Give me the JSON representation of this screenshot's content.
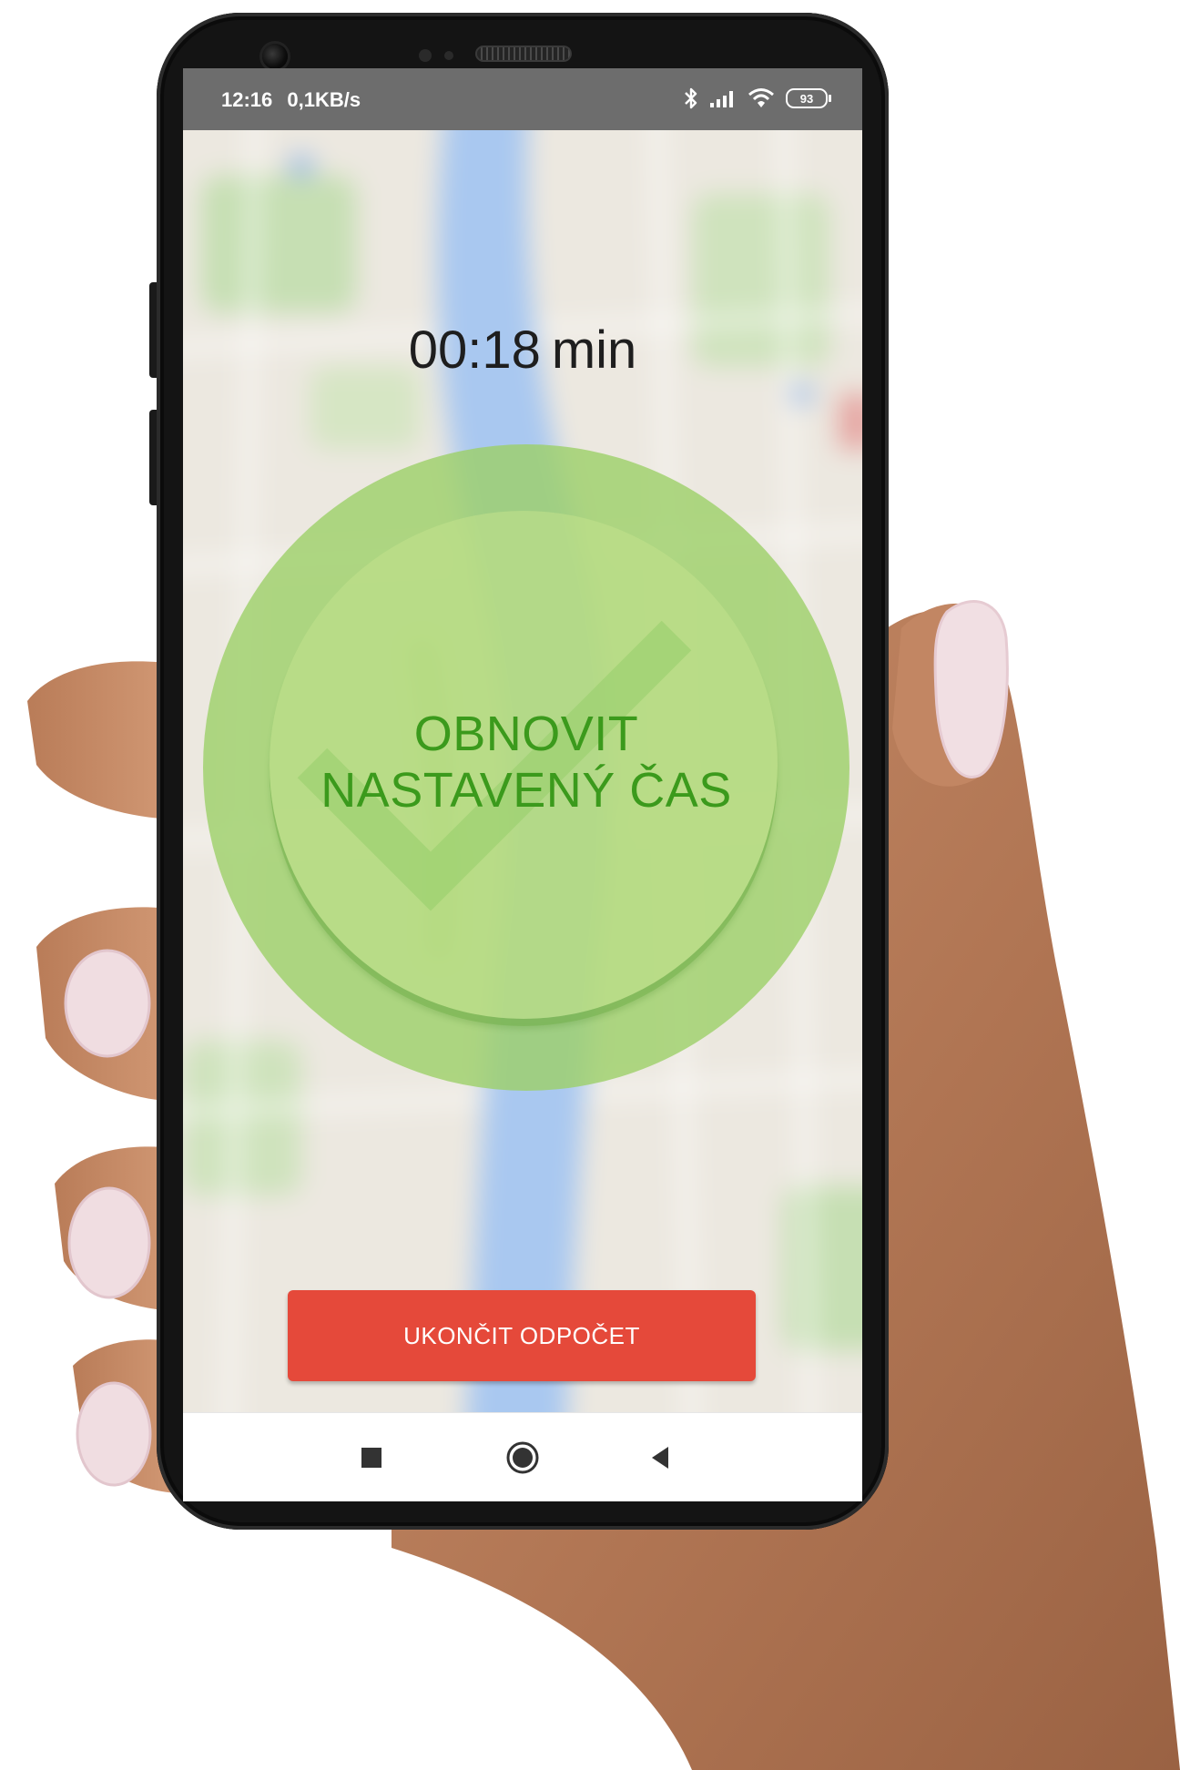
{
  "status_bar": {
    "time": "12:16",
    "speed": "0,1KB/s",
    "battery": "93",
    "icons": [
      "bluetooth-icon",
      "signal-icon",
      "wifi-icon",
      "battery-icon"
    ]
  },
  "timer": {
    "value": "00:18",
    "unit": "min"
  },
  "restart_button": {
    "line1": "OBNOVIT",
    "line2": "NASTAVENÝ ČAS",
    "icon": "checkmark-icon"
  },
  "end_button": {
    "label": "UKONČIT ODPOČET"
  },
  "nav_bar": {
    "buttons": [
      "recents-icon",
      "home-icon",
      "back-icon"
    ]
  },
  "colors": {
    "status_bar": "#6d6d6d",
    "accent_green": "#3b9a1c",
    "circle_green": "#9cd068",
    "end_button": "#e5493a",
    "map_water": "#a9c8f0",
    "map_land": "#ece8e0"
  }
}
